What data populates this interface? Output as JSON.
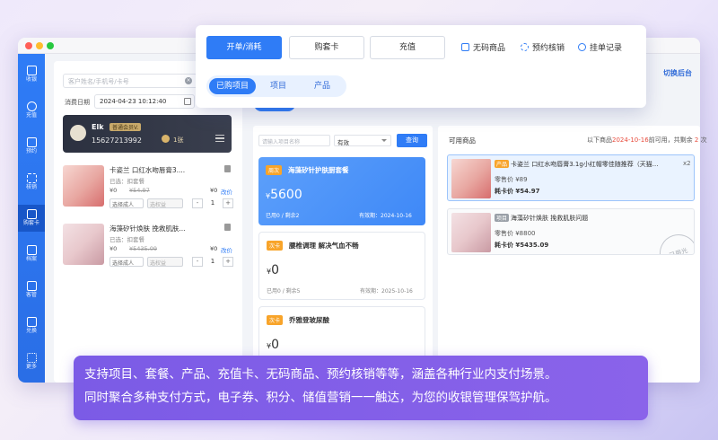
{
  "sidebar": {
    "items": [
      {
        "label": "收银"
      },
      {
        "label": "充值"
      },
      {
        "label": "预约"
      },
      {
        "label": "核销"
      },
      {
        "label": "购套卡"
      },
      {
        "label": "档案"
      },
      {
        "label": "客管"
      },
      {
        "label": "兑换"
      },
      {
        "label": "更多"
      }
    ],
    "active_index": 4
  },
  "popup": {
    "buttons": [
      "开单/消耗",
      "购套卡",
      "充值"
    ],
    "links": [
      "无码商品",
      "预约核销",
      "挂单记录"
    ],
    "segments": [
      "已购项目",
      "项目",
      "产品"
    ]
  },
  "top_right_link": "切换后台",
  "left": {
    "search_placeholder": "客户姓名/手机号/卡号",
    "search_clear": "×",
    "date_label": "消费日期",
    "date_value": "2024-04-23 10:12:40",
    "member": {
      "name": "Elk",
      "tag": "普通会员V.",
      "phone": "15627213992",
      "coupons": "1张"
    },
    "cart": [
      {
        "name": "卡姿兰 口红水吻唇膏3....",
        "selected": "已选：扣套餐",
        "price": "¥0",
        "orig": "¥54.97",
        "total": "¥0",
        "edit": "改价",
        "person": "选择成人",
        "rights": "选权益",
        "qty": "1",
        "minus": "-",
        "plus": "+"
      },
      {
        "name": "海藻矽针焕肤 挽救肌肤...",
        "selected": "已选：扣套餐",
        "price": "¥0",
        "orig": "¥5435.09",
        "total": "¥0",
        "edit": "改价",
        "person": "选择成人",
        "rights": "选权益",
        "qty": "1",
        "minus": "-",
        "plus": "+"
      }
    ]
  },
  "middle": {
    "search_placeholder": "请输入项目名称",
    "filter_value": "有效",
    "query_button": "查询",
    "packages": [
      {
        "badge": "周次",
        "title": "海藻矽针护肤厨套餐",
        "currency": "¥",
        "amount": "5600",
        "used": "已用0 / 剩余2",
        "valid": "有效期：2024-10-16"
      },
      {
        "badge": "次卡",
        "title": "腰椎调理 解决气血不畅",
        "currency": "¥",
        "amount": "0",
        "used": "已用0 / 剩余5",
        "valid": "有效期：2025-10-16"
      },
      {
        "badge": "次卡",
        "title": "乔雅登玻尿酸",
        "currency": "¥",
        "amount": "0",
        "used": "",
        "valid": ""
      }
    ]
  },
  "available": {
    "title": "可用商品",
    "summary_prefix": "以下商品",
    "summary_date": "2024-10-16",
    "summary_mid": "前可用，共剩余",
    "summary_count": "2",
    "summary_suffix": "次",
    "products": [
      {
        "badge": "产品",
        "name": "卡姿兰 口红水吻唇膏3.1g小红帽零佳随推荐（天猫...",
        "qty": "x2",
        "sale": "零售价 ¥89",
        "cost": "耗卡价 ¥54.97"
      },
      {
        "badge": "项目",
        "name": "海藻矽针焕肤 挽救肌肤问题",
        "qty": "",
        "sale": "零售价 ¥8800",
        "cost": "耗卡价 ¥5435.09",
        "stamp": "已用光"
      }
    ]
  },
  "caption": {
    "line1": "支持项目、套餐、产品、充值卡、无码商品、预约核销等等，涵盖各种行业内支付场景。",
    "line2": "同时聚合多种支付方式，电子券、积分、储值营销一一触达，为您的收银管理保驾护航。"
  }
}
